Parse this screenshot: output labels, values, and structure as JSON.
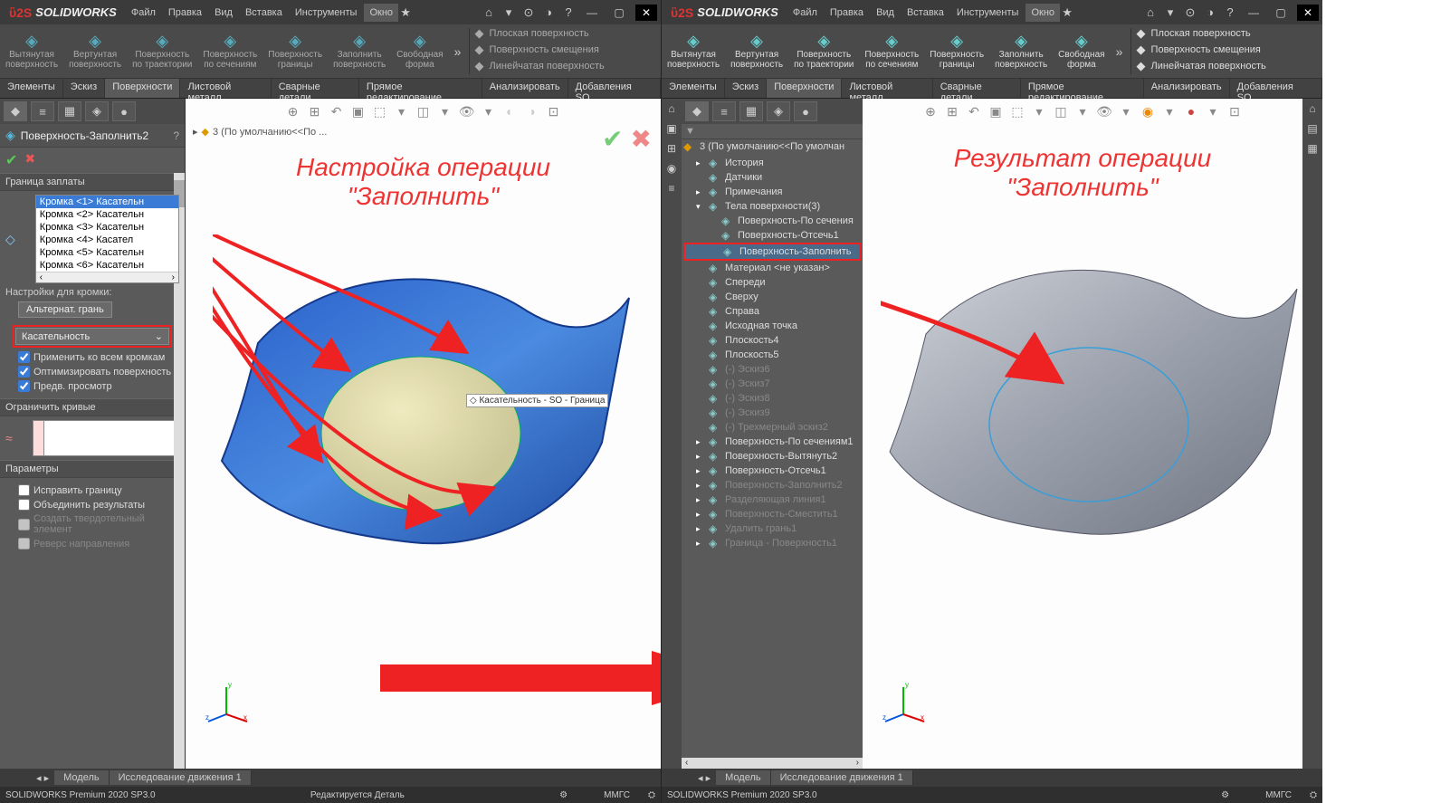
{
  "app": {
    "name": "SOLIDWORKS"
  },
  "menus": [
    "Файл",
    "Правка",
    "Вид",
    "Вставка",
    "Инструменты",
    "Окно"
  ],
  "ribbon_btns": [
    {
      "label": "Вытянутая поверхность",
      "en": false
    },
    {
      "label": "Вертунтая поверхность",
      "en": false
    },
    {
      "label": "Поверхность по траектории",
      "en": false
    },
    {
      "label": "Поверхность по сечениям",
      "en": false
    },
    {
      "label": "Поверхность границы",
      "en": false
    },
    {
      "label": "Заполнить поверхность",
      "en": false
    },
    {
      "label": "Свободная форма",
      "en": false
    }
  ],
  "ribbon_side": [
    "Плоская поверхность",
    "Поверхность смещения",
    "Линейчатая поверхность"
  ],
  "tabs": [
    "Элементы",
    "Эскиз",
    "Поверхности",
    "Листовой металл",
    "Сварные детали",
    "Прямое редактирование",
    "Анализировать",
    "Добавления SO..."
  ],
  "active_tab": "Поверхности",
  "left": {
    "feature_title": "Поверхность-Заполнить2",
    "crumb": "3  (По умолчанию<<По ...",
    "annot1": "Настройка операции",
    "annot2": "\"Заполнить\"",
    "tooltip": "Касательность - SO - Граница",
    "section_boundary": "Граница заплаты",
    "edges": [
      "Кромка <1> Касательн",
      "Кромка <2> Касательн",
      "Кромка <3> Касательн",
      "Кромка <4> Касател",
      "Кромка <5> Касательн",
      "Кромка <6> Касательн"
    ],
    "settings_lbl": "Настройки для кромки:",
    "alt_face_btn": "Альтернат. грань",
    "tangency_combo": "Касательность",
    "chk_apply": "Применить ко всем кромкам",
    "chk_optimize": "Оптимизировать поверхность",
    "chk_preview": "Предв. просмотр",
    "section_curves": "Ограничить кривые",
    "section_params": "Параметры",
    "chk_fix": "Исправить границу",
    "chk_merge": "Объединить результаты",
    "chk_solid": "Создать твердотельный элемент",
    "chk_reverse": "Реверс направления"
  },
  "right": {
    "crumb": "3 (По умолчанию<<По умолчан",
    "annot1": "Результат операции",
    "annot2": "\"Заполнить\"",
    "tree": [
      {
        "t": "История",
        "i": 1,
        "exp": "▸"
      },
      {
        "t": "Датчики",
        "i": 1
      },
      {
        "t": "Примечания",
        "i": 1,
        "exp": "▸"
      },
      {
        "t": "Тела поверхности(3)",
        "i": 1,
        "exp": "▾"
      },
      {
        "t": "Поверхность-По сечения",
        "i": 2
      },
      {
        "t": "Поверхность-Отсечь1",
        "i": 2
      },
      {
        "t": "Поверхность-Заполнить",
        "i": 2,
        "hl": true
      },
      {
        "t": "Материал <не указан>",
        "i": 1
      },
      {
        "t": "Спереди",
        "i": 1
      },
      {
        "t": "Сверху",
        "i": 1
      },
      {
        "t": "Справа",
        "i": 1
      },
      {
        "t": "Исходная точка",
        "i": 1
      },
      {
        "t": "Плоскость4",
        "i": 1
      },
      {
        "t": "Плоскость5",
        "i": 1
      },
      {
        "t": "(-) Эскиз6",
        "i": 1,
        "dim": true
      },
      {
        "t": "(-) Эскиз7",
        "i": 1,
        "dim": true
      },
      {
        "t": "(-) Эскиз8",
        "i": 1,
        "dim": true
      },
      {
        "t": "(-) Эскиз9",
        "i": 1,
        "dim": true
      },
      {
        "t": "(-) Трехмерный эскиз2",
        "i": 1,
        "dim": true
      },
      {
        "t": "Поверхность-По сечениям1",
        "i": 1,
        "exp": "▸"
      },
      {
        "t": "Поверхность-Вытянуть2",
        "i": 1,
        "exp": "▸"
      },
      {
        "t": "Поверхность-Отсечь1",
        "i": 1,
        "exp": "▸"
      },
      {
        "t": "Поверхность-Заполнить2",
        "i": 1,
        "dim": true,
        "exp": "▸"
      },
      {
        "t": "Разделяющая линия1",
        "i": 1,
        "dim": true,
        "exp": "▸"
      },
      {
        "t": "Поверхность-Сместить1",
        "i": 1,
        "dim": true,
        "exp": "▸"
      },
      {
        "t": "Удалить грань1",
        "i": 1,
        "dim": true,
        "exp": "▸"
      },
      {
        "t": "Граница - Поверхность1",
        "i": 1,
        "dim": true,
        "exp": "▸"
      }
    ]
  },
  "bottom_tabs": [
    "Модель",
    "Исследование движения 1"
  ],
  "status": {
    "left": "SOLIDWORKS Premium 2020 SP3.0",
    "mid_l": "Редактируется Деталь",
    "right": "ММГС"
  }
}
